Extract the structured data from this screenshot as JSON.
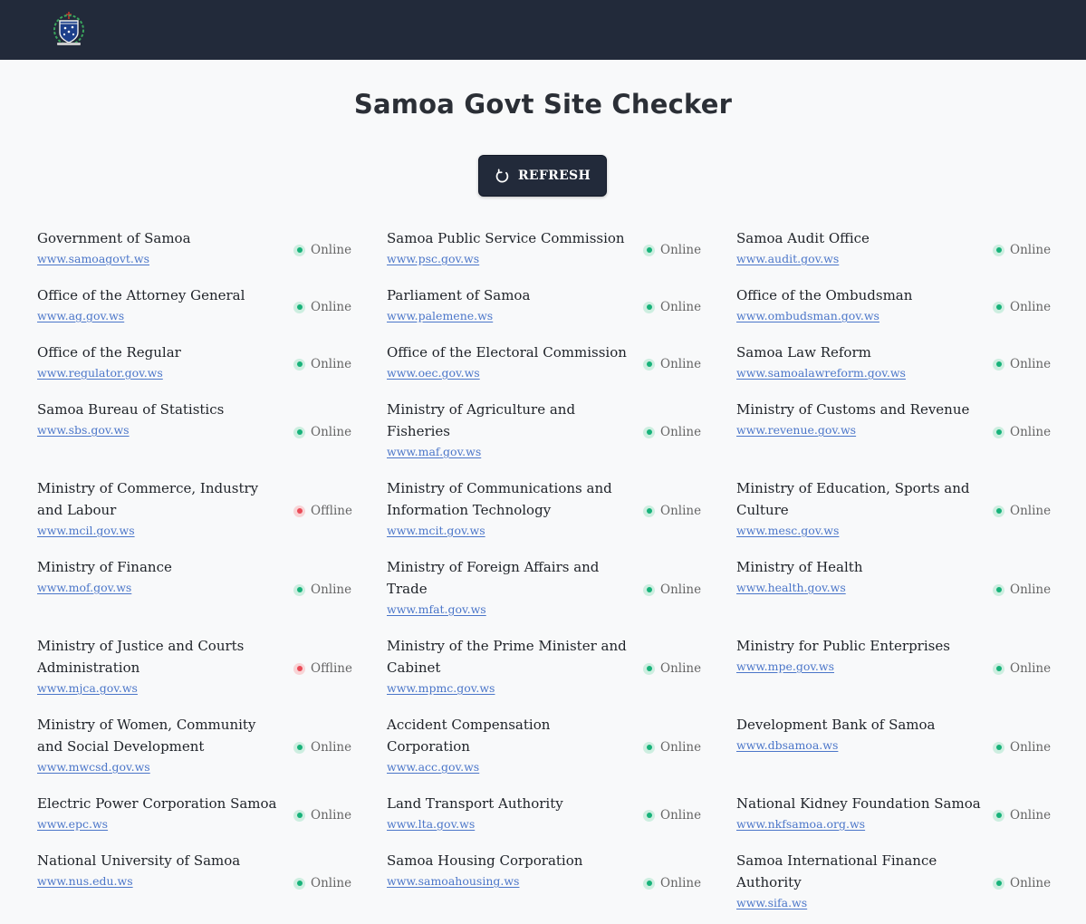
{
  "header": {
    "logo_icon": "samoa-coat-of-arms-icon",
    "bg_color": "#222a3a"
  },
  "page": {
    "title": "Samoa Govt Site Checker",
    "refresh_label": "REFRESH",
    "refresh_icon": "refresh-icon"
  },
  "status_colors": {
    "online": "#18b27a",
    "offline": "#ea4b57"
  },
  "sites": [
    [
      {
        "name": "Government of Samoa",
        "url": "www.samoagovt.ws",
        "status": "Online"
      },
      {
        "name": "Samoa Public Service Commission",
        "url": "www.psc.gov.ws",
        "status": "Online"
      },
      {
        "name": "Samoa Audit Office",
        "url": "www.audit.gov.ws",
        "status": "Online"
      }
    ],
    [
      {
        "name": "Office of the Attorney General",
        "url": "www.ag.gov.ws",
        "status": "Online"
      },
      {
        "name": "Parliament of Samoa",
        "url": "www.palemene.ws",
        "status": "Online"
      },
      {
        "name": "Office of the Ombudsman",
        "url": "www.ombudsman.gov.ws",
        "status": "Online"
      }
    ],
    [
      {
        "name": "Office of the Regular",
        "url": "www.regulator.gov.ws",
        "status": "Online"
      },
      {
        "name": "Office of the Electoral Commission",
        "url": "www.oec.gov.ws",
        "status": "Online"
      },
      {
        "name": "Samoa Law Reform",
        "url": "www.samoalawreform.gov.ws",
        "status": "Online"
      }
    ],
    [
      {
        "name": "Samoa Bureau of Statistics",
        "url": "www.sbs.gov.ws",
        "status": "Online"
      },
      {
        "name": "Ministry of Agriculture and Fisheries",
        "url": "www.maf.gov.ws",
        "status": "Online"
      },
      {
        "name": "Ministry of Customs and Revenue",
        "url": "www.revenue.gov.ws",
        "status": "Online"
      }
    ],
    [
      {
        "name": "Ministry of Commerce, Industry and Labour",
        "url": "www.mcil.gov.ws",
        "status": "Offline"
      },
      {
        "name": "Ministry of Communications and Information Technology",
        "url": "www.mcit.gov.ws",
        "status": "Online"
      },
      {
        "name": "Ministry of Education, Sports and Culture",
        "url": "www.mesc.gov.ws",
        "status": "Online"
      }
    ],
    [
      {
        "name": "Ministry of Finance",
        "url": "www.mof.gov.ws",
        "status": "Online"
      },
      {
        "name": "Ministry of Foreign Affairs and Trade",
        "url": "www.mfat.gov.ws",
        "status": "Online"
      },
      {
        "name": "Ministry of Health",
        "url": "www.health.gov.ws",
        "status": "Online"
      }
    ],
    [
      {
        "name": "Ministry of Justice and Courts Administration",
        "url": "www.mjca.gov.ws",
        "status": "Offline"
      },
      {
        "name": "Ministry of the Prime Minister and Cabinet",
        "url": "www.mpmc.gov.ws",
        "status": "Online"
      },
      {
        "name": "Ministry for Public Enterprises",
        "url": "www.mpe.gov.ws",
        "status": "Online"
      }
    ],
    [
      {
        "name": "Ministry of Women, Community and Social Development",
        "url": "www.mwcsd.gov.ws",
        "status": "Online"
      },
      {
        "name": "Accident Compensation Corporation",
        "url": "www.acc.gov.ws",
        "status": "Online"
      },
      {
        "name": "Development Bank of Samoa",
        "url": "www.dbsamoa.ws",
        "status": "Online"
      }
    ],
    [
      {
        "name": "Electric Power Corporation Samoa",
        "url": "www.epc.ws",
        "status": "Online"
      },
      {
        "name": "Land Transport Authority",
        "url": "www.lta.gov.ws",
        "status": "Online"
      },
      {
        "name": "National Kidney Foundation Samoa",
        "url": "www.nkfsamoa.org.ws",
        "status": "Online"
      }
    ],
    [
      {
        "name": "National University of Samoa",
        "url": "www.nus.edu.ws",
        "status": "Online"
      },
      {
        "name": "Samoa Housing Corporation",
        "url": "www.samoahousing.ws",
        "status": "Online"
      },
      {
        "name": "Samoa International Finance Authority",
        "url": "www.sifa.ws",
        "status": "Online"
      }
    ]
  ]
}
